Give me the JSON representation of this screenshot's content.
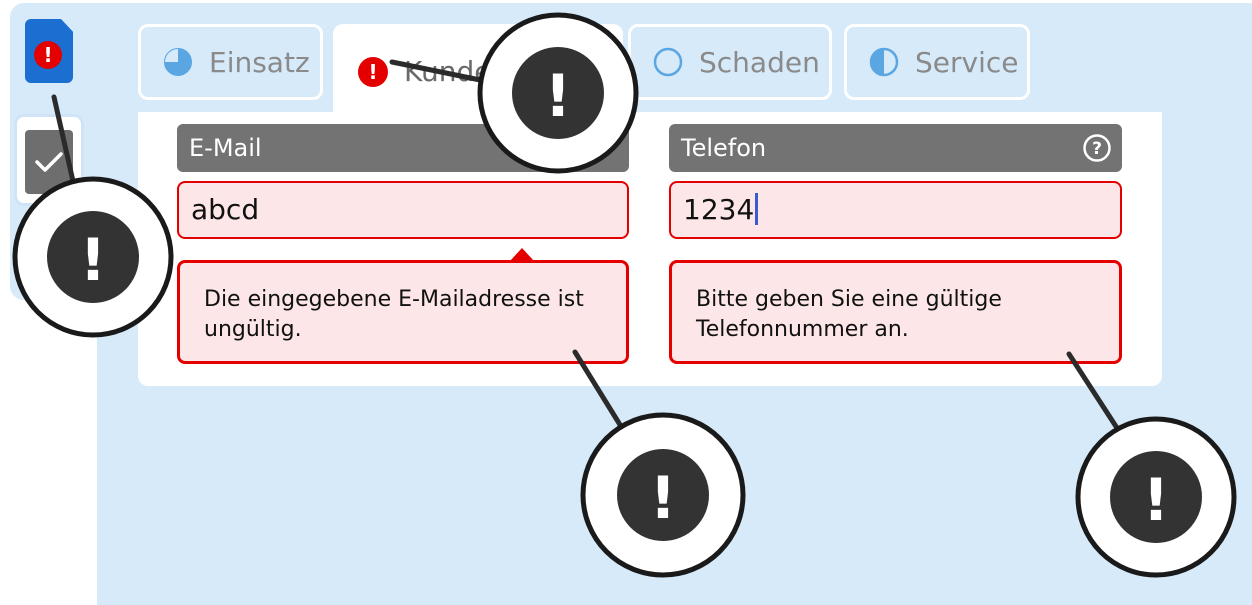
{
  "tabs": [
    {
      "label": "Einsatz",
      "state": "partial",
      "active": false
    },
    {
      "label": "Kunde",
      "state": "error",
      "active": true
    },
    {
      "label": "Schaden",
      "state": "empty",
      "active": false
    },
    {
      "label": "Service",
      "state": "half",
      "active": false
    }
  ],
  "rail": {
    "document_icon": "document-error-icon",
    "checked_icon": "checkmark-icon",
    "error_mark": "!"
  },
  "fields": {
    "email": {
      "label": "E-Mail",
      "value": "abcd",
      "error": "Die eingegebene E-Mailadresse ist ungültig."
    },
    "phone": {
      "label": "Telefon",
      "value": "1234",
      "help_icon": "help-circle-icon",
      "error": "Bitte geben Sie eine gültige Telefonnummer an."
    }
  },
  "callouts": [
    {
      "icon": "exclamation-icon",
      "mark": "!"
    },
    {
      "icon": "exclamation-icon",
      "mark": "!"
    },
    {
      "icon": "exclamation-icon",
      "mark": "!"
    },
    {
      "icon": "exclamation-icon",
      "mark": "!"
    }
  ],
  "colors": {
    "background": "#d7eaf9",
    "error": "#e50000",
    "error_fill": "#fde6e8",
    "label_bg": "#737373",
    "accent": "#1a6fd0",
    "progress_icon": "#5aa6e3"
  }
}
